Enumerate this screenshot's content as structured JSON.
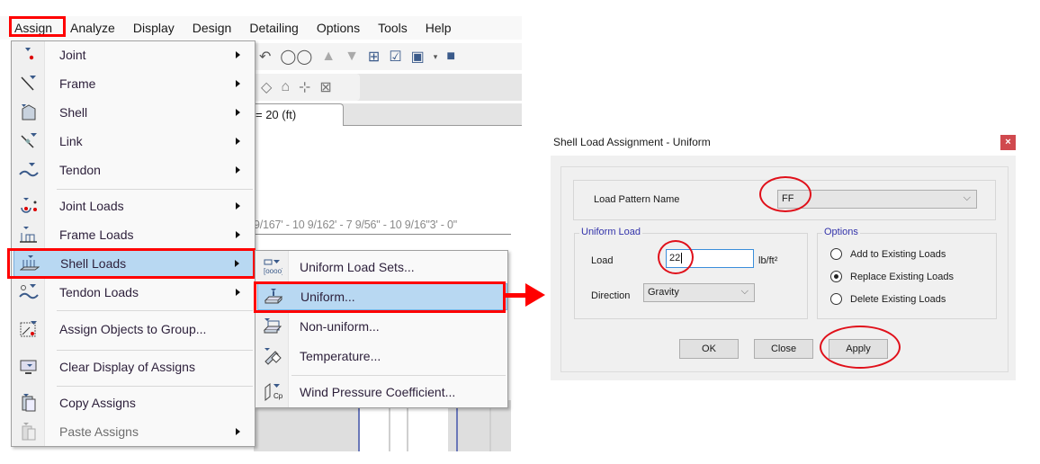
{
  "menubar": {
    "items": [
      "Assign",
      "Analyze",
      "Display",
      "Design",
      "Detailing",
      "Options",
      "Tools",
      "Help"
    ]
  },
  "toolbar": {
    "icons": [
      "undo-icon",
      "glasses-icon",
      "up-arrow-icon",
      "down-arrow-icon",
      "select-icon",
      "checkbox-icon",
      "box-icon",
      "dropdown-icon",
      "cube-icon"
    ]
  },
  "view_tab": {
    "label": "= 20 (ft)"
  },
  "canvas": {
    "dimension_text": "9/167' - 10 9/162' - 7 9/56\" - 10 9/16\"3' - 0\""
  },
  "assign_menu": {
    "items": [
      {
        "label": "Joint",
        "icon": "joint-icon",
        "submenu": true
      },
      {
        "label": "Frame",
        "icon": "frame-icon",
        "submenu": true
      },
      {
        "label": "Shell",
        "icon": "shell-icon",
        "submenu": true
      },
      {
        "label": "Link",
        "icon": "link-icon",
        "submenu": true
      },
      {
        "label": "Tendon",
        "icon": "tendon-icon",
        "submenu": true
      },
      {
        "label": "Joint Loads",
        "icon": "joint-loads-icon",
        "submenu": true
      },
      {
        "label": "Frame Loads",
        "icon": "frame-loads-icon",
        "submenu": true
      },
      {
        "label": "Shell Loads",
        "icon": "shell-loads-icon",
        "submenu": true,
        "active": true
      },
      {
        "label": "Tendon Loads",
        "icon": "tendon-loads-icon",
        "submenu": true
      },
      {
        "label": "Assign Objects to Group...",
        "icon": "group-icon",
        "submenu": false
      },
      {
        "label": "Clear Display of Assigns",
        "icon": "clear-display-icon",
        "submenu": false
      },
      {
        "label": "Copy Assigns",
        "icon": "copy-icon",
        "submenu": false
      },
      {
        "label": "Paste Assigns",
        "icon": "paste-icon",
        "submenu": true,
        "disabled": true
      }
    ]
  },
  "shell_loads_submenu": {
    "items": [
      {
        "label": "Uniform Load Sets...",
        "icon": "uniform-load-sets-icon"
      },
      {
        "label": "Uniform...",
        "icon": "uniform-load-icon",
        "active": true
      },
      {
        "label": "Non-uniform...",
        "icon": "non-uniform-load-icon"
      },
      {
        "label": "Temperature...",
        "icon": "temperature-icon"
      },
      {
        "label": "Wind Pressure Coefficient...",
        "icon": "wind-pressure-icon"
      }
    ]
  },
  "dialog": {
    "title": "Shell Load Assignment - Uniform",
    "close_label": "×",
    "load_pattern_label": "Load Pattern Name",
    "load_pattern_value": "FF",
    "uniform_load_group": "Uniform Load",
    "load_label": "Load",
    "load_value": "22",
    "load_unit": "lb/ft²",
    "direction_label": "Direction",
    "direction_value": "Gravity",
    "options_group": "Options",
    "options": [
      {
        "label": "Add to Existing Loads",
        "selected": false
      },
      {
        "label": "Replace Existing Loads",
        "selected": true
      },
      {
        "label": "Delete Existing Loads",
        "selected": false
      }
    ],
    "buttons": {
      "ok": "OK",
      "close": "Close",
      "apply": "Apply"
    }
  },
  "annotation_colors": {
    "highlight": "#ff0000",
    "ellipse": "#e0101a",
    "menu_active": "#b8d8f2"
  }
}
